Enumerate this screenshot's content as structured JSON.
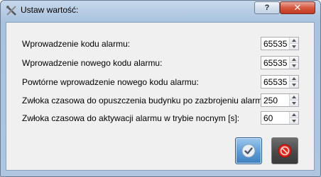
{
  "window": {
    "title": "Ustaw wartość:",
    "help_label": "?",
    "close_label": "✕"
  },
  "fields": [
    {
      "label": "Wprowadzenie kodu alarmu:",
      "value": "65535"
    },
    {
      "label": "Wprowadzenie nowego kodu alarmu:",
      "value": "65535"
    },
    {
      "label": "Powtórne wprowadzenie nowego kodu alarmu:",
      "value": "65535"
    },
    {
      "label": "Zwłoka czasowa do opuszczenia budynku po zazbrojeniu alarmu [s]:",
      "value": "250"
    },
    {
      "label": "Zwłoka czasowa do aktywacji alarmu w trybie nocnym [s]:",
      "value": "60"
    }
  ],
  "buttons": {
    "ok_icon": "checkmark-icon",
    "cancel_icon": "no-entry-icon"
  }
}
